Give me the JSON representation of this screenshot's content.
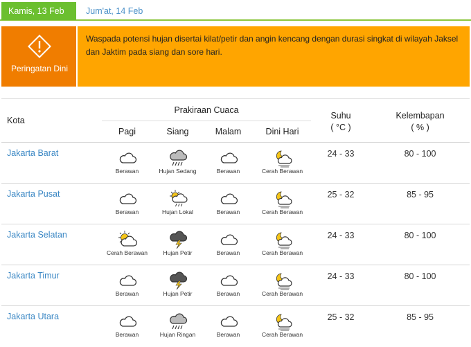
{
  "tabs": [
    {
      "label": "Kamis, 13 Feb",
      "active": true
    },
    {
      "label": "Jum'at, 14 Feb",
      "active": false
    }
  ],
  "warning": {
    "label": "Peringatan Dini",
    "icon": "warning-icon",
    "text": "Waspada potensi hujan disertai kilat/petir dan angin kencang dengan durasi singkat di wilayah Jaksel dan Jaktim pada siang dan sore hari."
  },
  "table": {
    "headers": {
      "kota": "Kota",
      "group": "Prakiraan Cuaca",
      "times": [
        "Pagi",
        "Siang",
        "Malam",
        "Dini Hari"
      ],
      "suhu": "Suhu",
      "suhu_unit": "( °C )",
      "kelembapan": "Kelembapan",
      "kelembapan_unit": "( % )"
    },
    "rows": [
      {
        "kota": "Jakarta Barat",
        "forecast": [
          {
            "label": "Berawan",
            "icon": "cloud"
          },
          {
            "label": "Hujan Sedang",
            "icon": "rain"
          },
          {
            "label": "Berawan",
            "icon": "cloud"
          },
          {
            "label": "Cerah Berawan",
            "icon": "moon-cloud"
          }
        ],
        "suhu": "24 - 33",
        "kelembapan": "80 - 100"
      },
      {
        "kota": "Jakarta Pusat",
        "forecast": [
          {
            "label": "Berawan",
            "icon": "cloud"
          },
          {
            "label": "Hujan Lokal",
            "icon": "sun-rain"
          },
          {
            "label": "Berawan",
            "icon": "cloud"
          },
          {
            "label": "Cerah Berawan",
            "icon": "moon-cloud"
          }
        ],
        "suhu": "25 - 32",
        "kelembapan": "85 - 95"
      },
      {
        "kota": "Jakarta Selatan",
        "forecast": [
          {
            "label": "Cerah Berawan",
            "icon": "sun-cloud"
          },
          {
            "label": "Hujan Petir",
            "icon": "thunder"
          },
          {
            "label": "Berawan",
            "icon": "cloud"
          },
          {
            "label": "Cerah Berawan",
            "icon": "moon-cloud"
          }
        ],
        "suhu": "24 - 33",
        "kelembapan": "80 - 100"
      },
      {
        "kota": "Jakarta Timur",
        "forecast": [
          {
            "label": "Berawan",
            "icon": "cloud"
          },
          {
            "label": "Hujan Petir",
            "icon": "thunder"
          },
          {
            "label": "Berawan",
            "icon": "cloud"
          },
          {
            "label": "Cerah Berawan",
            "icon": "moon-cloud"
          }
        ],
        "suhu": "24 - 33",
        "kelembapan": "80 - 100"
      },
      {
        "kota": "Jakarta Utara",
        "forecast": [
          {
            "label": "Berawan",
            "icon": "cloud"
          },
          {
            "label": "Hujan Ringan",
            "icon": "rain"
          },
          {
            "label": "Berawan",
            "icon": "cloud"
          },
          {
            "label": "Cerah Berawan",
            "icon": "moon-cloud"
          }
        ],
        "suhu": "25 - 32",
        "kelembapan": "85 - 95"
      }
    ]
  },
  "colors": {
    "tab_active": "#6bbf2f",
    "warning_dark": "#f07d00",
    "warning_light": "#ffa500",
    "city_link": "#3a87c4"
  }
}
